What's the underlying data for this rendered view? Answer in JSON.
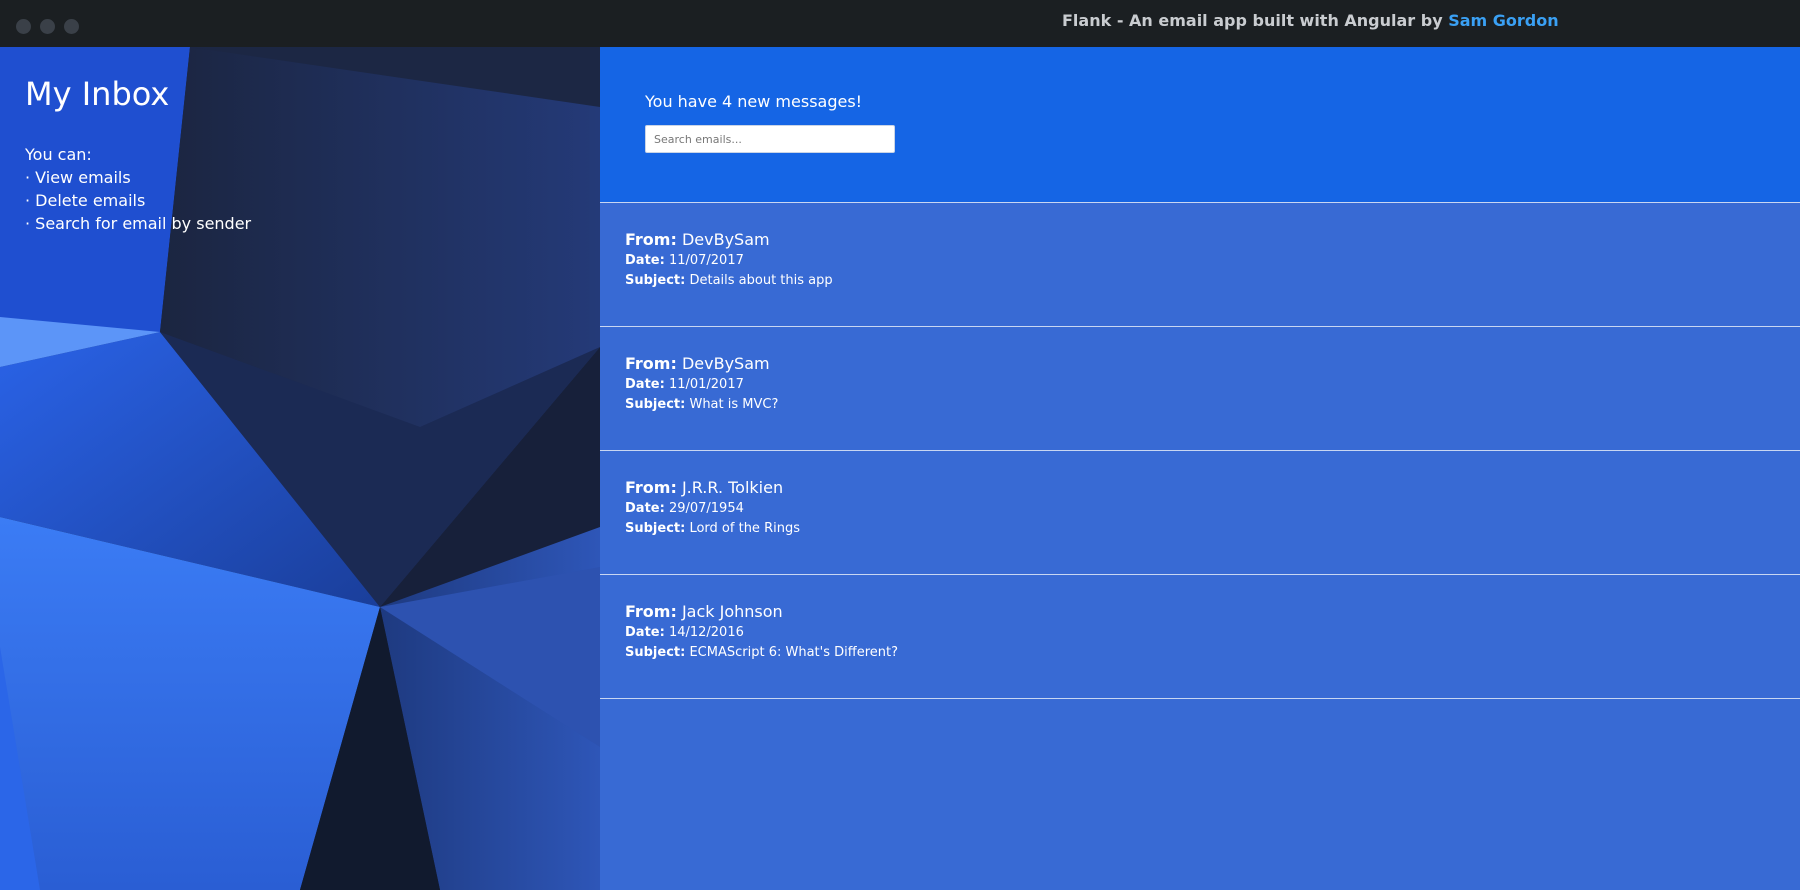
{
  "window": {
    "title_prefix": "Flank - An email app built with Angular by ",
    "author": "Sam Gordon"
  },
  "sidebar": {
    "title": "My Inbox",
    "intro": "You can:",
    "items": [
      {
        "label": "View emails"
      },
      {
        "label": "Delete emails"
      },
      {
        "label": "Search for email by sender"
      }
    ]
  },
  "header": {
    "new_messages": "You have 4 new messages!",
    "search_placeholder": "Search emails..."
  },
  "labels": {
    "from": "From:",
    "date": "Date:",
    "subject": "Subject:"
  },
  "emails": [
    {
      "from": "DevBySam",
      "date": "11/07/2017",
      "subject": "Details about this app"
    },
    {
      "from": "DevBySam",
      "date": "11/01/2017",
      "subject": "What is MVC?"
    },
    {
      "from": "J.R.R. Tolkien",
      "date": "29/07/1954",
      "subject": "Lord of the Rings"
    },
    {
      "from": "Jack Johnson",
      "date": "14/12/2016",
      "subject": "ECMAScript 6: What's Different?"
    }
  ],
  "colors": {
    "titlebar": "#1b1f22",
    "author_link": "#3aa0f4",
    "header_panel": "#1565e5",
    "email_list": "#386ad4",
    "sidebar_dark": "#162038"
  }
}
